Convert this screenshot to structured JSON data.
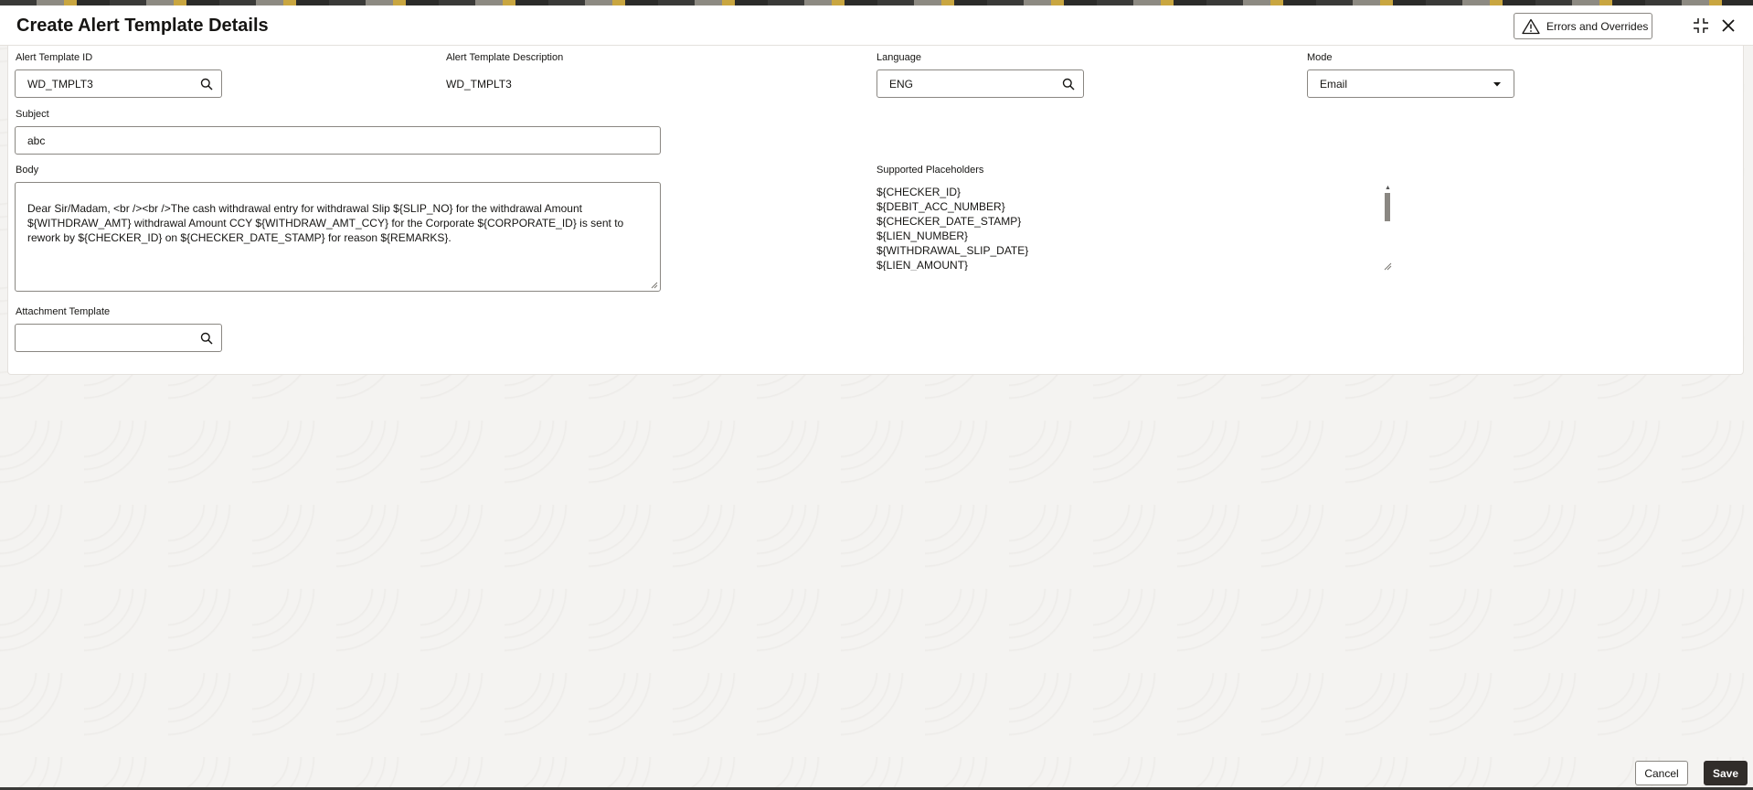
{
  "header": {
    "title": "Create Alert Template Details",
    "errors_button": "Errors and Overrides",
    "icons": [
      "warning-icon",
      "minimize-icon",
      "close-icon"
    ]
  },
  "form": {
    "template_id": {
      "label": "Alert Template ID",
      "value": "WD_TMPLT3"
    },
    "template_description": {
      "label": "Alert Template Description",
      "value": "WD_TMPLT3"
    },
    "language": {
      "label": "Language",
      "value": "ENG"
    },
    "mode": {
      "label": "Mode",
      "value": "Email"
    },
    "subject": {
      "label": "Subject",
      "value": "abc"
    },
    "body": {
      "label": "Body",
      "value": "Dear Sir/Madam, <br /><br />The cash withdrawal entry for withdrawal Slip ${SLIP_NO} for the withdrawal Amount ${WITHDRAW_AMT} withdrawal Amount CCY ${WITHDRAW_AMT_CCY} for the Corporate ${CORPORATE_ID} is sent to rework by ${CHECKER_ID} on ${CHECKER_DATE_STAMP} for reason ${REMARKS}."
    },
    "supported_placeholders": {
      "label": "Supported Placeholders",
      "items": [
        "${CHECKER_ID}",
        "${DEBIT_ACC_NUMBER}",
        "${CHECKER_DATE_STAMP}",
        "${LIEN_NUMBER}",
        "${WITHDRAWAL_SLIP_DATE}",
        "${LIEN_AMOUNT}"
      ]
    },
    "attachment_template": {
      "label": "Attachment Template",
      "value": ""
    }
  },
  "footer": {
    "cancel_label": "Cancel",
    "save_label": "Save"
  }
}
